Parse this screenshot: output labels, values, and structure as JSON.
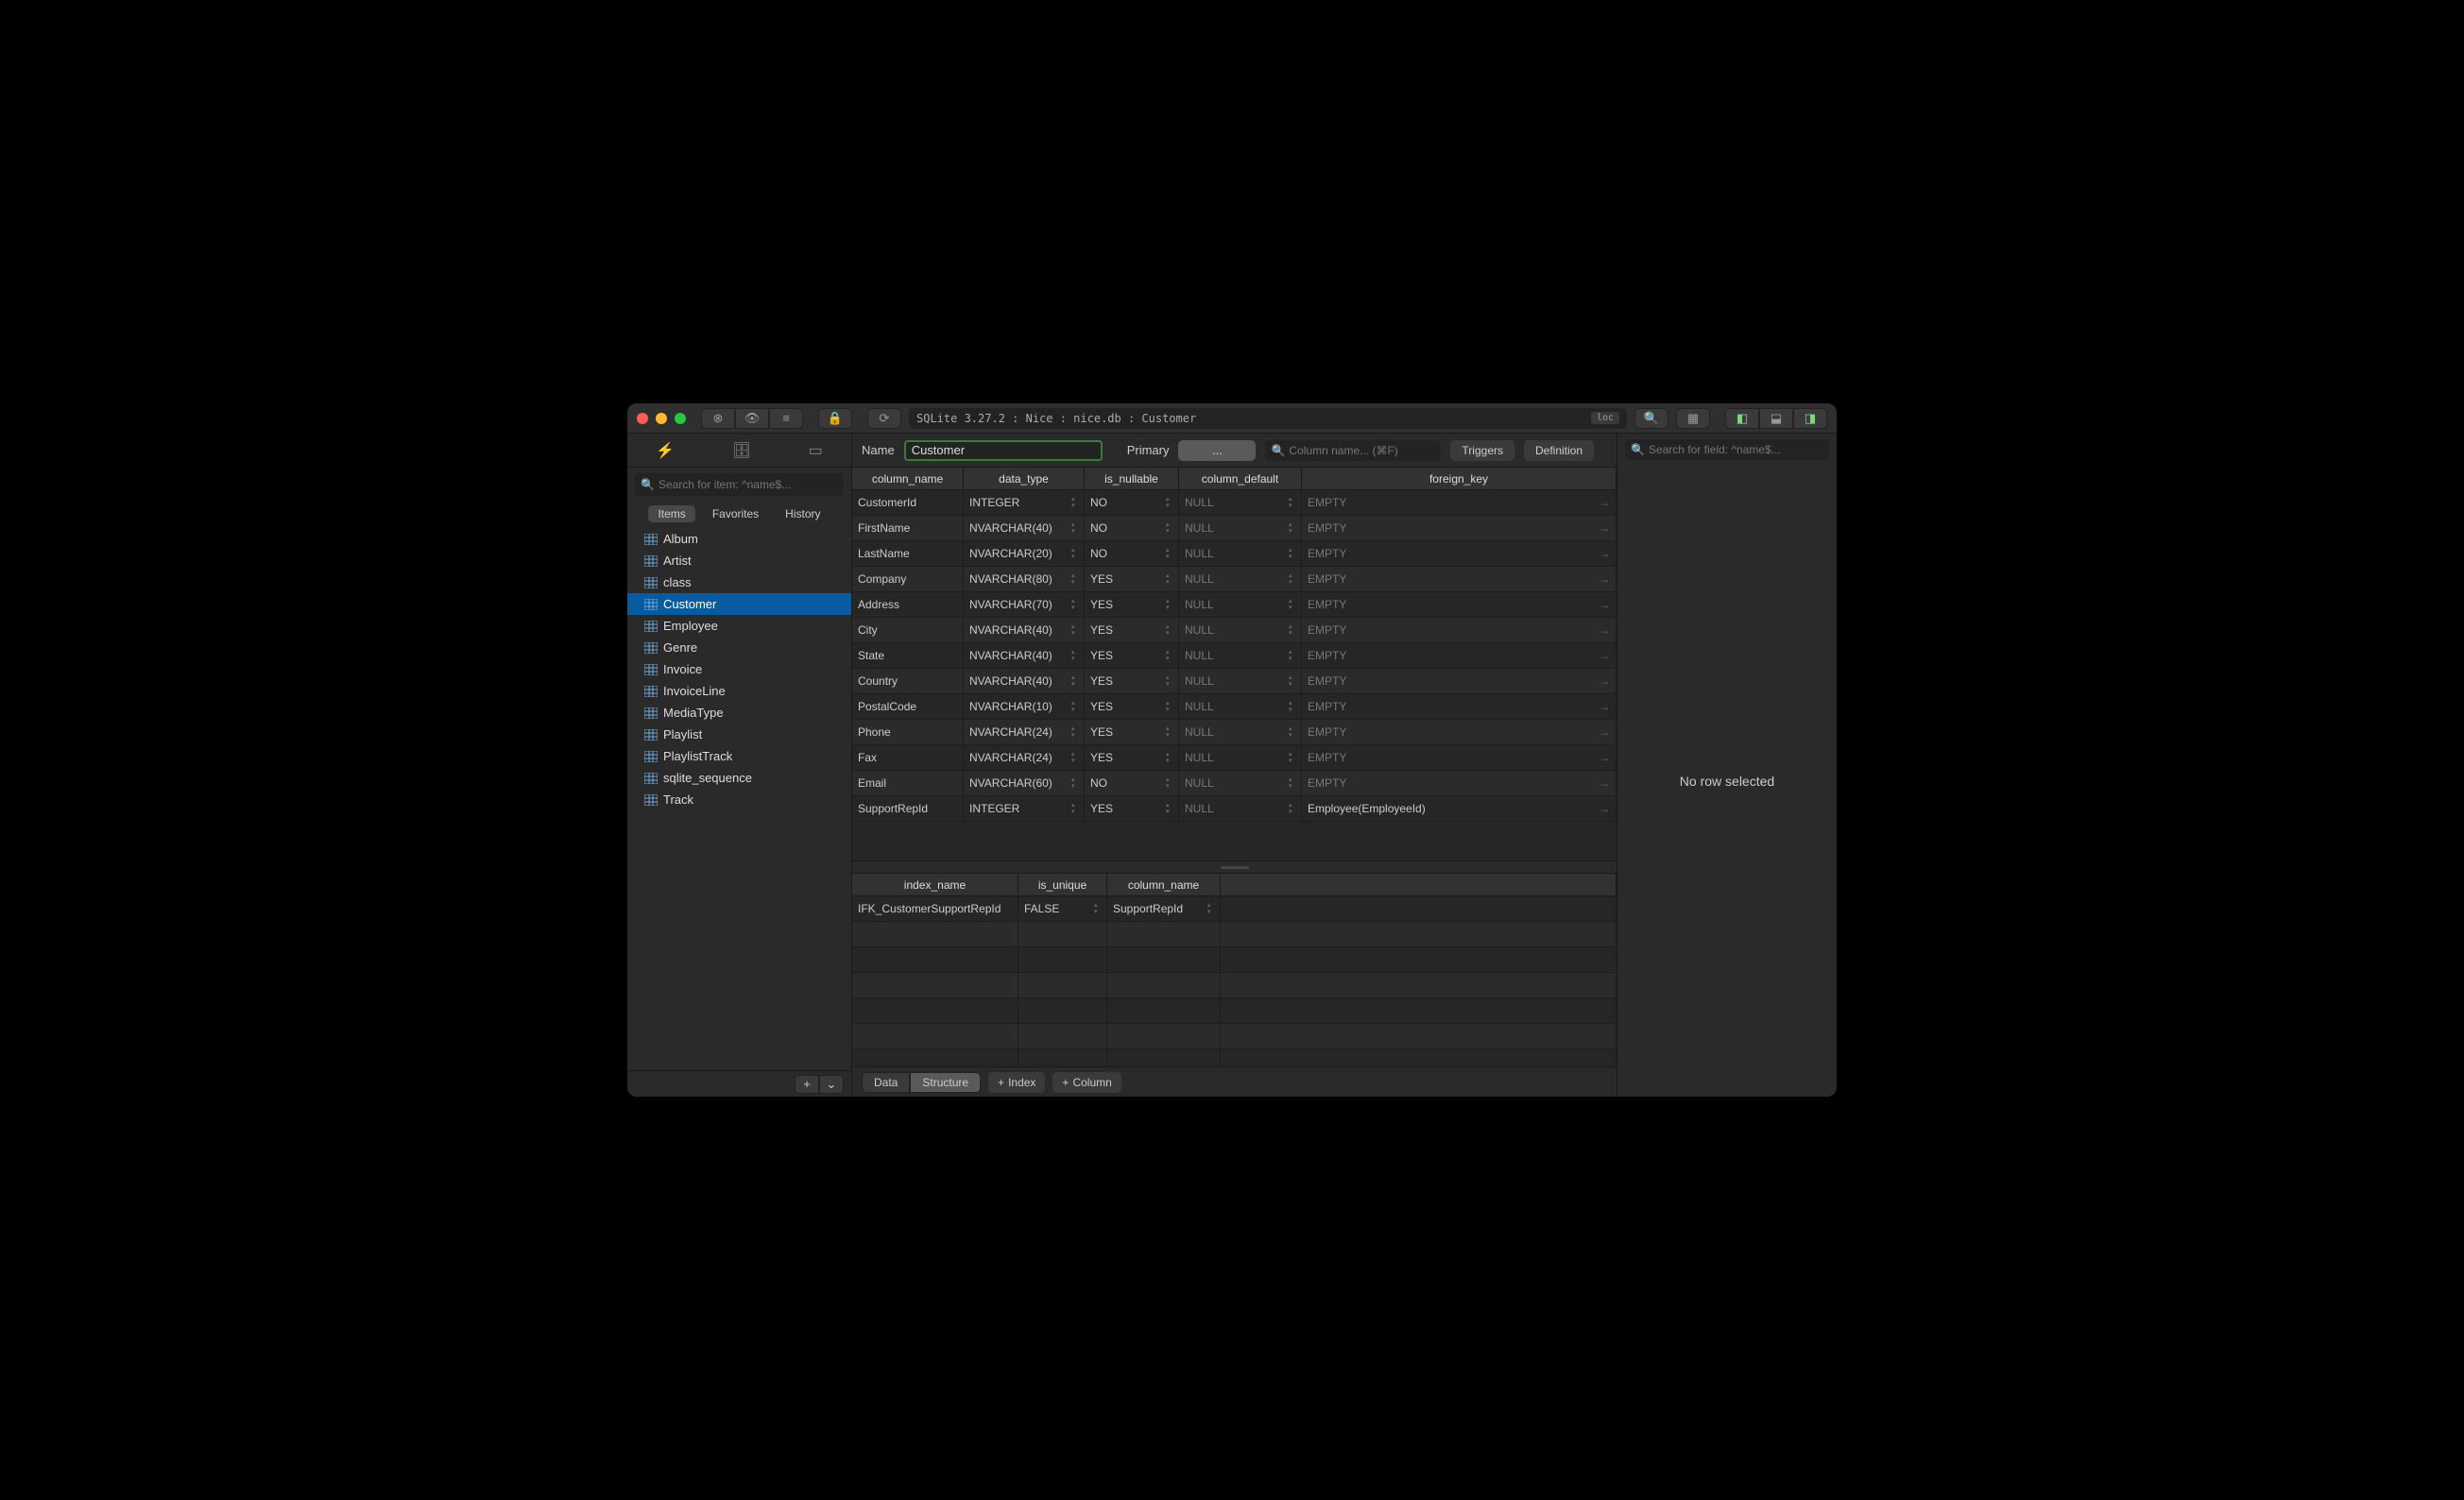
{
  "titlebar": {
    "breadcrumb": "SQLite 3.27.2 : Nice : nice.db : Customer",
    "loc_badge": "loc"
  },
  "sidebar": {
    "search_placeholder": "Search for item: ^name$...",
    "tabs": [
      "Items",
      "Favorites",
      "History"
    ],
    "active_tab": 0,
    "items": [
      {
        "label": "Album"
      },
      {
        "label": "Artist"
      },
      {
        "label": "class"
      },
      {
        "label": "Customer",
        "selected": true
      },
      {
        "label": "Employee"
      },
      {
        "label": "Genre"
      },
      {
        "label": "Invoice"
      },
      {
        "label": "InvoiceLine"
      },
      {
        "label": "MediaType"
      },
      {
        "label": "Playlist"
      },
      {
        "label": "PlaylistTrack"
      },
      {
        "label": "sqlite_sequence"
      },
      {
        "label": "Track"
      }
    ]
  },
  "header": {
    "name_label": "Name",
    "name_value": "Customer",
    "primary_label": "Primary",
    "primary_value": "...",
    "col_search_placeholder": "Column name... (⌘F)",
    "triggers_label": "Triggers",
    "definition_label": "Definition"
  },
  "columns_grid": {
    "headers": [
      "column_name",
      "data_type",
      "is_nullable",
      "column_default",
      "foreign_key"
    ],
    "rows": [
      {
        "name": "CustomerId",
        "type": "INTEGER",
        "nullable": "NO",
        "default": "NULL",
        "fk": "EMPTY"
      },
      {
        "name": "FirstName",
        "type": "NVARCHAR(40)",
        "nullable": "NO",
        "default": "NULL",
        "fk": "EMPTY"
      },
      {
        "name": "LastName",
        "type": "NVARCHAR(20)",
        "nullable": "NO",
        "default": "NULL",
        "fk": "EMPTY"
      },
      {
        "name": "Company",
        "type": "NVARCHAR(80)",
        "nullable": "YES",
        "default": "NULL",
        "fk": "EMPTY"
      },
      {
        "name": "Address",
        "type": "NVARCHAR(70)",
        "nullable": "YES",
        "default": "NULL",
        "fk": "EMPTY"
      },
      {
        "name": "City",
        "type": "NVARCHAR(40)",
        "nullable": "YES",
        "default": "NULL",
        "fk": "EMPTY"
      },
      {
        "name": "State",
        "type": "NVARCHAR(40)",
        "nullable": "YES",
        "default": "NULL",
        "fk": "EMPTY"
      },
      {
        "name": "Country",
        "type": "NVARCHAR(40)",
        "nullable": "YES",
        "default": "NULL",
        "fk": "EMPTY"
      },
      {
        "name": "PostalCode",
        "type": "NVARCHAR(10)",
        "nullable": "YES",
        "default": "NULL",
        "fk": "EMPTY"
      },
      {
        "name": "Phone",
        "type": "NVARCHAR(24)",
        "nullable": "YES",
        "default": "NULL",
        "fk": "EMPTY"
      },
      {
        "name": "Fax",
        "type": "NVARCHAR(24)",
        "nullable": "YES",
        "default": "NULL",
        "fk": "EMPTY"
      },
      {
        "name": "Email",
        "type": "NVARCHAR(60)",
        "nullable": "NO",
        "default": "NULL",
        "fk": "EMPTY"
      },
      {
        "name": "SupportRepId",
        "type": "INTEGER",
        "nullable": "YES",
        "default": "NULL",
        "fk": "Employee(EmployeeId)"
      }
    ]
  },
  "indexes_grid": {
    "headers": [
      "index_name",
      "is_unique",
      "column_name"
    ],
    "rows": [
      {
        "name": "IFK_CustomerSupportRepId",
        "unique": "FALSE",
        "col": "SupportRepId"
      }
    ]
  },
  "footer": {
    "data_label": "Data",
    "structure_label": "Structure",
    "index_label": "Index",
    "column_label": "Column"
  },
  "right_pane": {
    "search_placeholder": "Search for field: ^name$...",
    "empty_text": "No row selected"
  }
}
